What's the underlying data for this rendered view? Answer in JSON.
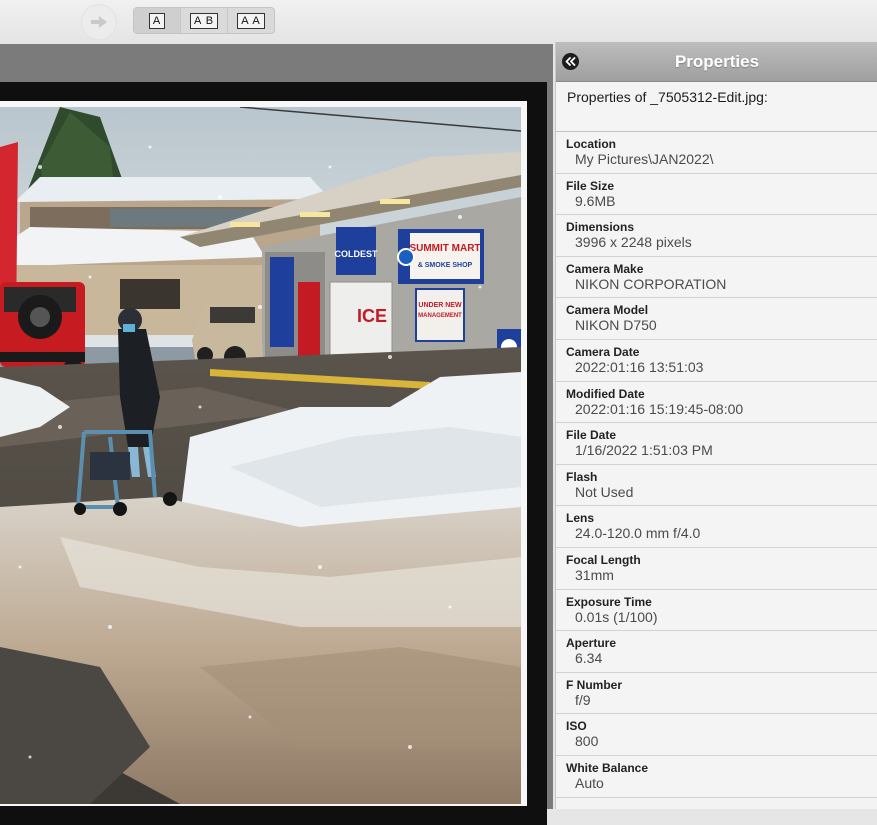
{
  "toolbar": {
    "forward_icon": "arrow-right-icon",
    "view_modes": [
      {
        "label": "A",
        "active": true
      },
      {
        "label": "A B",
        "active": false
      },
      {
        "label": "A A",
        "active": false
      }
    ]
  },
  "panel": {
    "title": "Properties",
    "collapse_icon": "double-chevron-left-icon",
    "subtitle": "Properties of _7505312-Edit.jpg:",
    "properties": [
      {
        "label": "Location",
        "value": "My Pictures\\JAN2022\\"
      },
      {
        "label": "File Size",
        "value": "9.6MB"
      },
      {
        "label": "Dimensions",
        "value": "3996 x 2248 pixels"
      },
      {
        "label": "Camera Make",
        "value": "NIKON CORPORATION"
      },
      {
        "label": "Camera Model",
        "value": "NIKON D750"
      },
      {
        "label": "Camera Date",
        "value": "2022:01:16 13:51:03"
      },
      {
        "label": "Modified Date",
        "value": "2022:01:16 15:19:45-08:00"
      },
      {
        "label": "File Date",
        "value": "1/16/2022 1:51:03 PM"
      },
      {
        "label": "Flash",
        "value": "Not Used"
      },
      {
        "label": "Lens",
        "value": "24.0-120.0 mm f/4.0"
      },
      {
        "label": "Focal Length",
        "value": "31mm"
      },
      {
        "label": "Exposure Time",
        "value": "0.01s (1/100)"
      },
      {
        "label": "Aperture",
        "value": "6.34"
      },
      {
        "label": "F Number",
        "value": "f/9"
      },
      {
        "label": "ISO",
        "value": "800"
      },
      {
        "label": "White Balance",
        "value": "Auto"
      }
    ]
  },
  "photo": {
    "signs": {
      "store_name_1": "SUMMIT MART",
      "store_name_2": "& SMOKE SHOP",
      "ice": "ICE",
      "management_1": "UNDER NEW",
      "management_2": "MANAGEMENT",
      "coldest": "COLDEST"
    }
  }
}
